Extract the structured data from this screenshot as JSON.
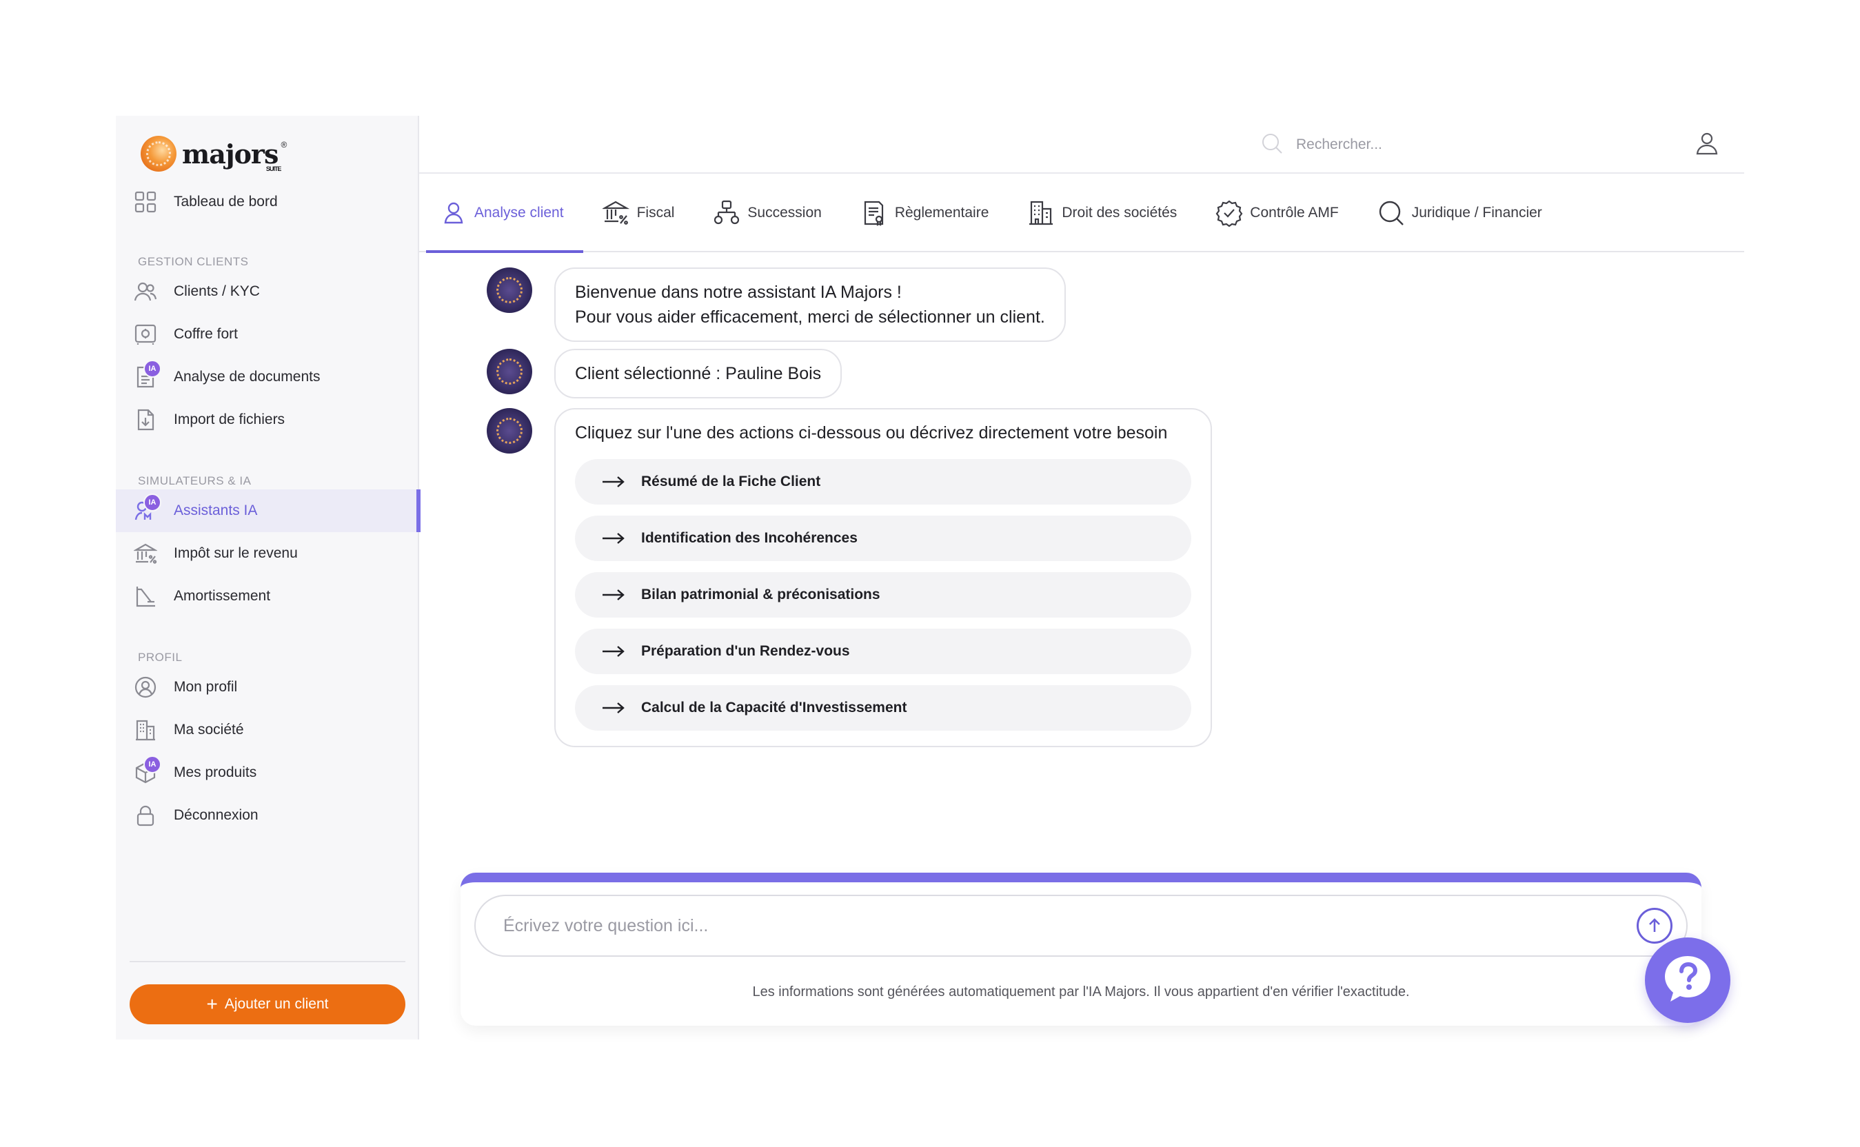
{
  "brand": {
    "name": "majors",
    "sup": "®",
    "suite": "SUITE"
  },
  "sidebar": {
    "dashboard": {
      "label": "Tableau de bord",
      "icon": "grid-icon"
    },
    "sections": [
      {
        "title": "GESTION CLIENTS",
        "items": [
          {
            "label": "Clients / KYC",
            "icon": "users-icon"
          },
          {
            "label": "Coffre fort",
            "icon": "safe-icon"
          },
          {
            "label": "Analyse de documents",
            "icon": "document-ia-icon",
            "badge": "IA"
          },
          {
            "label": "Import de fichiers",
            "icon": "file-import-icon"
          }
        ]
      },
      {
        "title": "SIMULATEURS & IA",
        "items": [
          {
            "label": "Assistants IA",
            "icon": "assistant-ia-icon",
            "badge": "IA",
            "active": true
          },
          {
            "label": "Impôt sur le revenu",
            "icon": "tax-bank-icon"
          },
          {
            "label": "Amortissement",
            "icon": "chart-axis-icon"
          }
        ]
      },
      {
        "title": "PROFIL",
        "items": [
          {
            "label": "Mon profil",
            "icon": "profile-circle-icon"
          },
          {
            "label": "Ma société",
            "icon": "building-icon"
          },
          {
            "label": "Mes produits",
            "icon": "box-ia-icon",
            "badge": "IA"
          },
          {
            "label": "Déconnexion",
            "icon": "lock-icon"
          }
        ]
      }
    ],
    "add_client_label": "Ajouter un client"
  },
  "header": {
    "search_placeholder": "Rechercher..."
  },
  "tabs": [
    {
      "label": "Analyse client",
      "active": true
    },
    {
      "label": "Fiscal"
    },
    {
      "label": "Succession"
    },
    {
      "label": "Règlementaire"
    },
    {
      "label": "Droit des sociétés"
    },
    {
      "label": "Contrôle AMF"
    },
    {
      "label": "Juridique / Financier"
    }
  ],
  "chat": {
    "messages": [
      {
        "lines": [
          "Bienvenue dans notre assistant IA Majors !",
          "Pour vous aider efficacement, merci de sélectionner un client."
        ]
      },
      {
        "lines": [
          "Client sélectionné : Pauline Bois"
        ]
      },
      {
        "lines": [
          "Cliquez sur l'une des actions ci-dessous ou décrivez directement votre besoin"
        ]
      }
    ],
    "actions": [
      "Résumé de la Fiche Client",
      "Identification des Incohérences",
      "Bilan patrimonial & préconisations",
      "Préparation d'un Rendez-vous",
      "Calcul de la Capacité d'Investissement"
    ]
  },
  "composer": {
    "placeholder": "Écrivez votre question ici...",
    "disclaimer": "Les informations sont générées automatiquement par l'IA Majors. Il vous appartient d'en vérifier l'exactitude."
  },
  "colors": {
    "accent": "#6b5fd9",
    "cta": "#ec6e12",
    "badge": "#8a5fe0"
  }
}
